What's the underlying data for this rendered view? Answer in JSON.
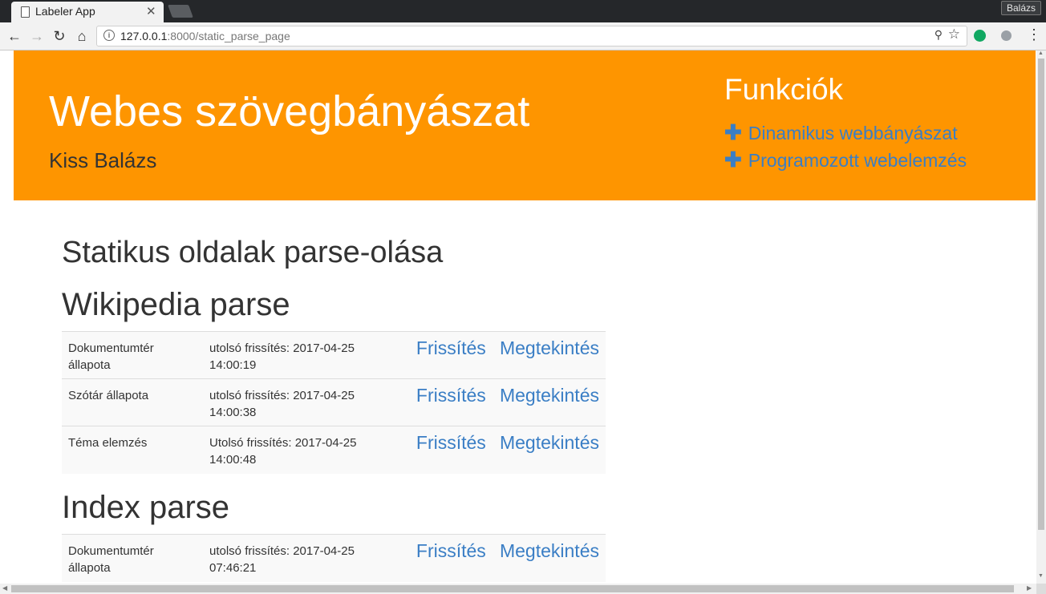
{
  "browser": {
    "tab_title": "Labeler App",
    "profile_name": "Balázs",
    "url_host": "127.0.0.1",
    "url_rest": ":8000/static_parse_page",
    "close_glyph": "✕"
  },
  "header": {
    "title": "Webes szövegbányászat",
    "subtitle": "Kiss Balázs",
    "functions_title": "Funkciók",
    "links": [
      {
        "label": "Dinamikus webbányászat"
      },
      {
        "label": "Programozott webelemzés"
      }
    ]
  },
  "main": {
    "page_title": "Statikus oldalak parse-olása",
    "sections": [
      {
        "title": "Wikipedia parse",
        "rows": [
          {
            "name": "Dokumentumtér állapota",
            "date": "utolsó frissítés: 2017-04-25 14:00:19",
            "refresh": "Frissítés",
            "view": "Megtekintés"
          },
          {
            "name": "Szótár állapota",
            "date": "utolsó frissítés: 2017-04-25 14:00:38",
            "refresh": "Frissítés",
            "view": "Megtekintés"
          },
          {
            "name": "Téma elemzés",
            "date": "Utolsó frissítés: 2017-04-25 14:00:48",
            "refresh": "Frissítés",
            "view": "Megtekintés"
          }
        ]
      },
      {
        "title": "Index parse",
        "rows": [
          {
            "name": "Dokumentumtér állapota",
            "date": "utolsó frissítés: 2017-04-25 07:46:21",
            "refresh": "Frissítés",
            "view": "Megtekintés"
          }
        ]
      }
    ]
  },
  "colors": {
    "header_bg": "#fe9500",
    "link": "#3a7ec5",
    "text": "#333333"
  }
}
